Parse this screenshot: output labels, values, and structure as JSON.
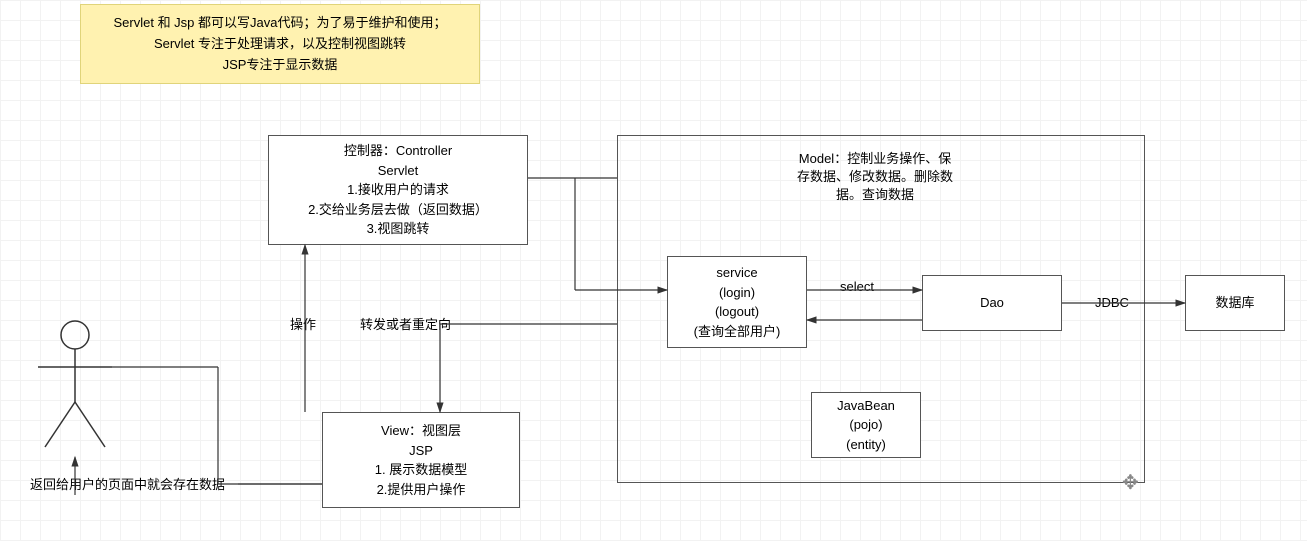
{
  "note": {
    "line1": "Servlet 和 Jsp  都可以写Java代码；为了易于维护和使用；",
    "line2": "Servlet 专注于处理请求，以及控制视图跳转",
    "line3": "JSP专注于显示数据"
  },
  "controller": {
    "title": "控制器：Controller",
    "sub": "Servlet",
    "l1": "1.接收用户的请求",
    "l2": "2.交给业务层去做（返回数据）",
    "l3": "3.视图跳转"
  },
  "view": {
    "title": "View：视图层",
    "sub": "JSP",
    "l1": "1. 展示数据模型",
    "l2": "2.提供用户操作"
  },
  "model": {
    "title1": "Model：控制业务操作、保",
    "title2": "存数据、修改数据。删除数",
    "title3": "据。查询数据"
  },
  "service": {
    "l1": "service",
    "l2": "(login)",
    "l3": "(logout)",
    "l4": "(查询全部用户)"
  },
  "javabean": {
    "l1": "JavaBean",
    "l2": "(pojo)",
    "l3": "(entity)"
  },
  "dao": {
    "label": "Dao"
  },
  "db": {
    "label": "数据库"
  },
  "edges": {
    "operate": "操作",
    "forward": "转发或者重定向",
    "select": "select",
    "jdbc": "JDBC",
    "return_to_user": "返回给用户的页面中就会存在数据"
  }
}
